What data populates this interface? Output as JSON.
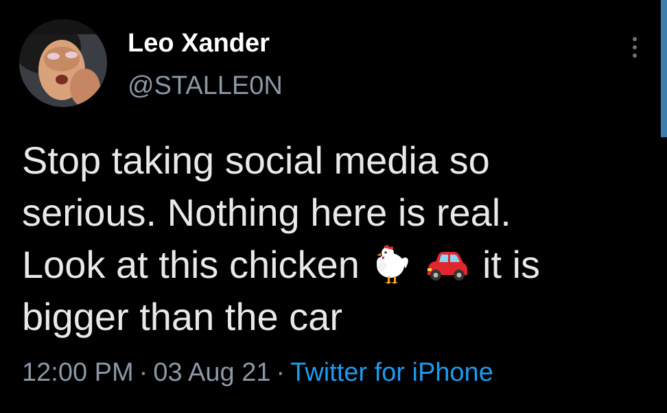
{
  "author": {
    "display_name": "Leo Xander",
    "handle": "@STALLE0N"
  },
  "tweet": {
    "text_line_1": "Stop taking social media so",
    "text_line_2": "serious. Nothing here is real.",
    "text_line_3a": "Look at this chicken",
    "text_line_3b": "it is",
    "text_line_4": "bigger than the car",
    "emojis": [
      "chicken-emoji",
      "car-emoji"
    ]
  },
  "meta": {
    "time": "12:00 PM",
    "separator": "·",
    "date": "03 Aug 21",
    "source": "Twitter for iPhone"
  },
  "colors": {
    "background": "#000000",
    "text": "#e7e9ea",
    "secondary_text": "#8b98a5",
    "link": "#1d9bf0",
    "scroll_indicator": "#3b7fb0"
  },
  "icons": {
    "more": "more-vertical-icon"
  }
}
